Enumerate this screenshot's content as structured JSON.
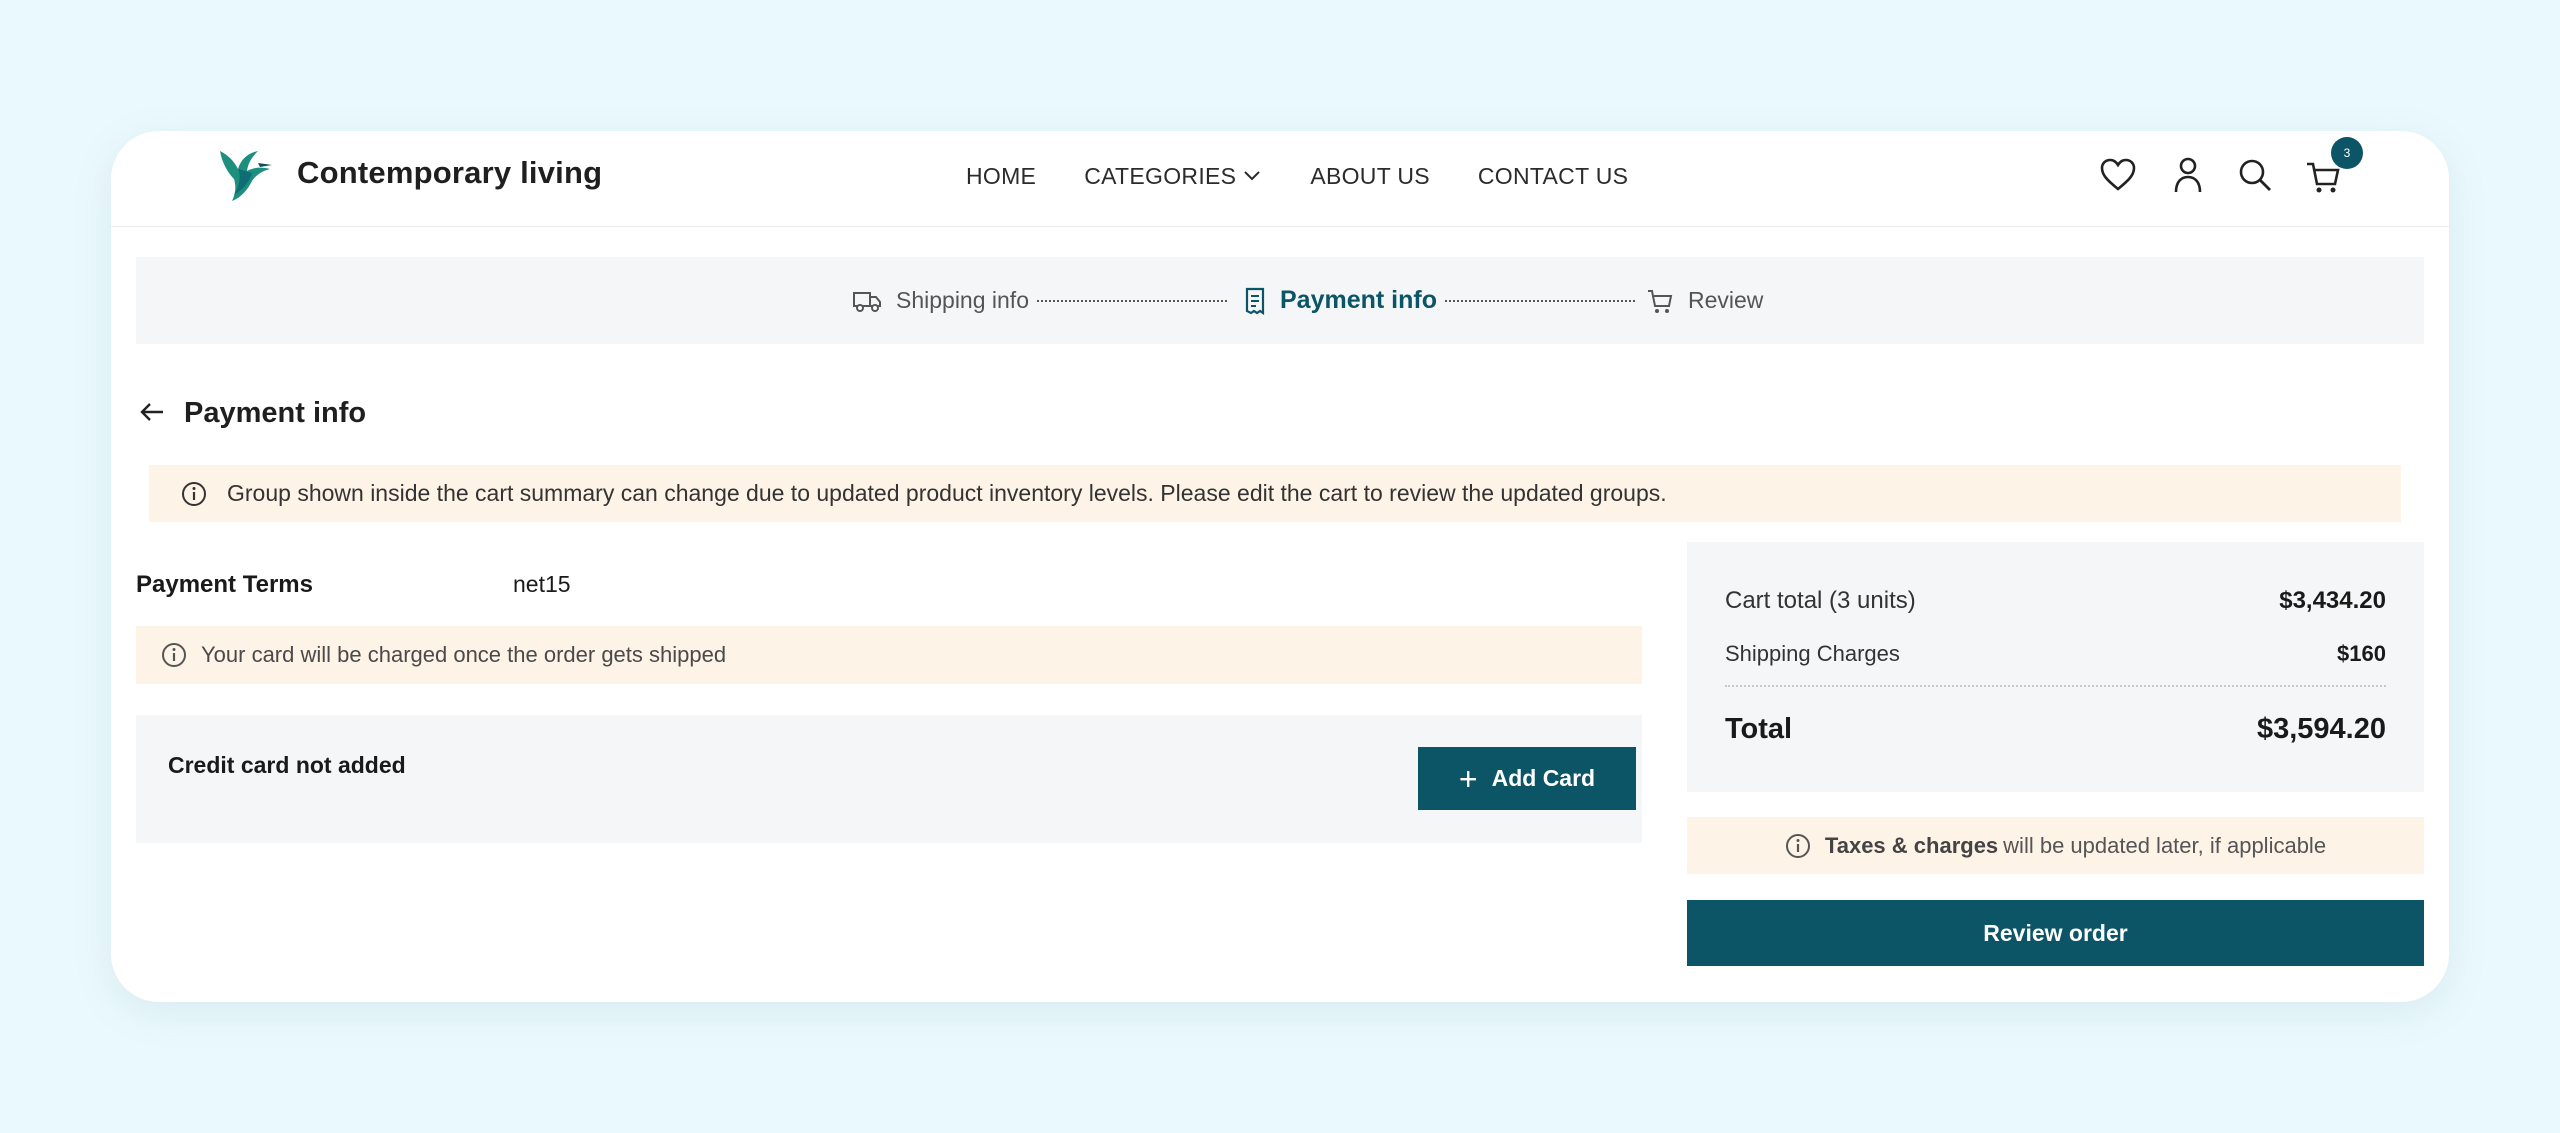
{
  "brand": {
    "name": "Contemporary living"
  },
  "nav": {
    "home": "HOME",
    "categories": "CATEGORIES",
    "about": "ABOUT US",
    "contact": "CONTACT US"
  },
  "header_icons": [
    "heart-icon",
    "user-icon",
    "search-icon",
    "cart-icon"
  ],
  "cart_count": "3",
  "stepper": {
    "shipping": "Shipping info",
    "payment": "Payment info",
    "review": "Review"
  },
  "page": {
    "title": "Payment info"
  },
  "notice": "Group shown inside the cart summary can change due to updated product inventory levels. Please edit the cart to review the updated groups.",
  "payment": {
    "terms_label": "Payment Terms",
    "terms_value": "net15",
    "charge_note": "Your card will be charged once the order gets shipped",
    "cc_status": "Credit card not added",
    "add_card": "Add Card"
  },
  "summary": {
    "cart_total_label": "Cart total (3 units)",
    "cart_total_value": "$3,434.20",
    "shipping_label": "Shipping Charges",
    "shipping_value": "$160",
    "total_label": "Total",
    "total_value": "$3,594.20"
  },
  "tax_note": {
    "bold": "Taxes & charges",
    "rest": "will be updated later, if applicable"
  },
  "review_button": "Review order",
  "colors": {
    "accent": "#0b5566",
    "notice_bg": "#fdf4e7",
    "panel_bg": "#f5f6f7",
    "page_bg": "#eaf9fd"
  }
}
